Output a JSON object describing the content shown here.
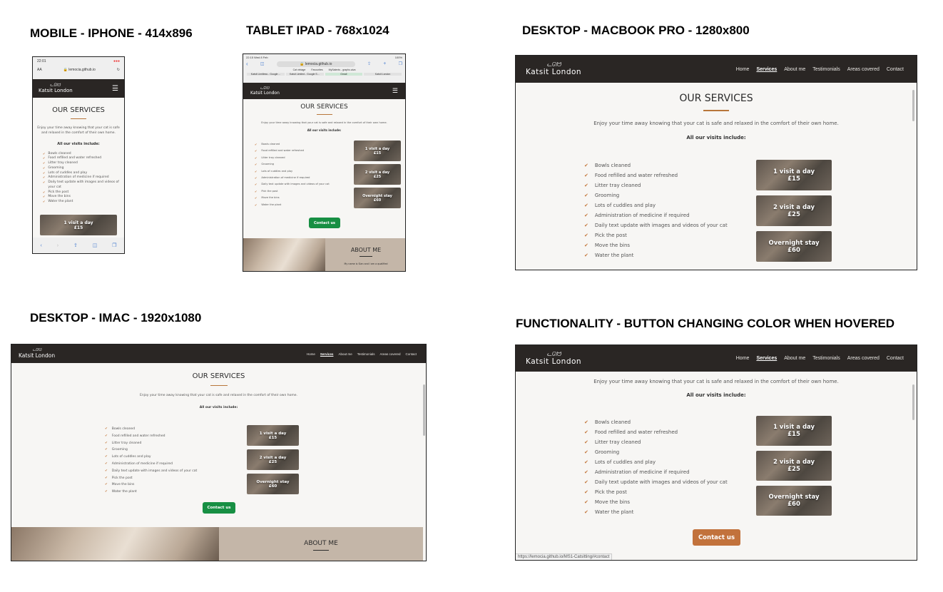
{
  "captions": {
    "mobile": "MOBILE - IPHONE - 414x896",
    "tablet": "TABLET IPAD - 768x1024",
    "macbook": "DESKTOP -  MACBOOK PRO - 1280x800",
    "imac": "DESKTOP - IMAC - 1920x1080",
    "functionality": "FUNCTIONALITY - BUTTON CHANGING COLOR WHEN HOVERED"
  },
  "site": {
    "brand": "Katsit London",
    "nav": [
      "Home",
      "Services",
      "About me",
      "Testimonials",
      "Areas covered",
      "Contact"
    ],
    "services_title": "OUR SERVICES",
    "intro": "Enjoy your time away knowing that your cat is safe and relaxed in the comfort of their own home.",
    "visits_head": "All our visits include:",
    "visits": [
      "Bowls cleaned",
      "Food refilled and water refreshed",
      "Litter tray cleaned",
      "Grooming",
      "Lots of cuddles and play",
      "Administration of medicine if required",
      "Daily text update with images and videos of your cat",
      "Pick the post",
      "Move the bins",
      "Water the plant"
    ],
    "cards": [
      {
        "label": "1 visit a day",
        "price": "£15"
      },
      {
        "label": "2 visit a day",
        "price": "£25"
      },
      {
        "label": "Overnight stay",
        "price": "£60"
      }
    ],
    "contact_label": "Contact us",
    "about_title": "ABOUT ME",
    "about_snippet": "My name is Sian and I am a qualified"
  },
  "mobile_browser": {
    "time": "22:01",
    "aa": "AA",
    "url": "lemocia.github.io",
    "intro_line1": "Enjoy your time away knowing that your cat is safe",
    "intro_line2": "and relaxed in the comfort of their own home."
  },
  "tablet_browser": {
    "time": "22:15  Wed 8 Feb",
    "battery": "100%",
    "url": "lemocia.github.io",
    "bookmarks": [
      "Cat vintage",
      "Favourites",
      "MySalents - grapho.aiva"
    ],
    "tabs": [
      "Katsit Limitless - Google…",
      "Katsit Limited - Google S…",
      "Gmail",
      "Katsit London"
    ]
  },
  "hover_status_url": "https://lemocia.github.io/MS1-Catsitting/#contact",
  "colors": {
    "nav_bg": "#2a2624",
    "accent": "#b8763a",
    "button_green": "#178f43",
    "button_hover_orange": "#c2723c",
    "about_panel": "#c4b6a8"
  }
}
